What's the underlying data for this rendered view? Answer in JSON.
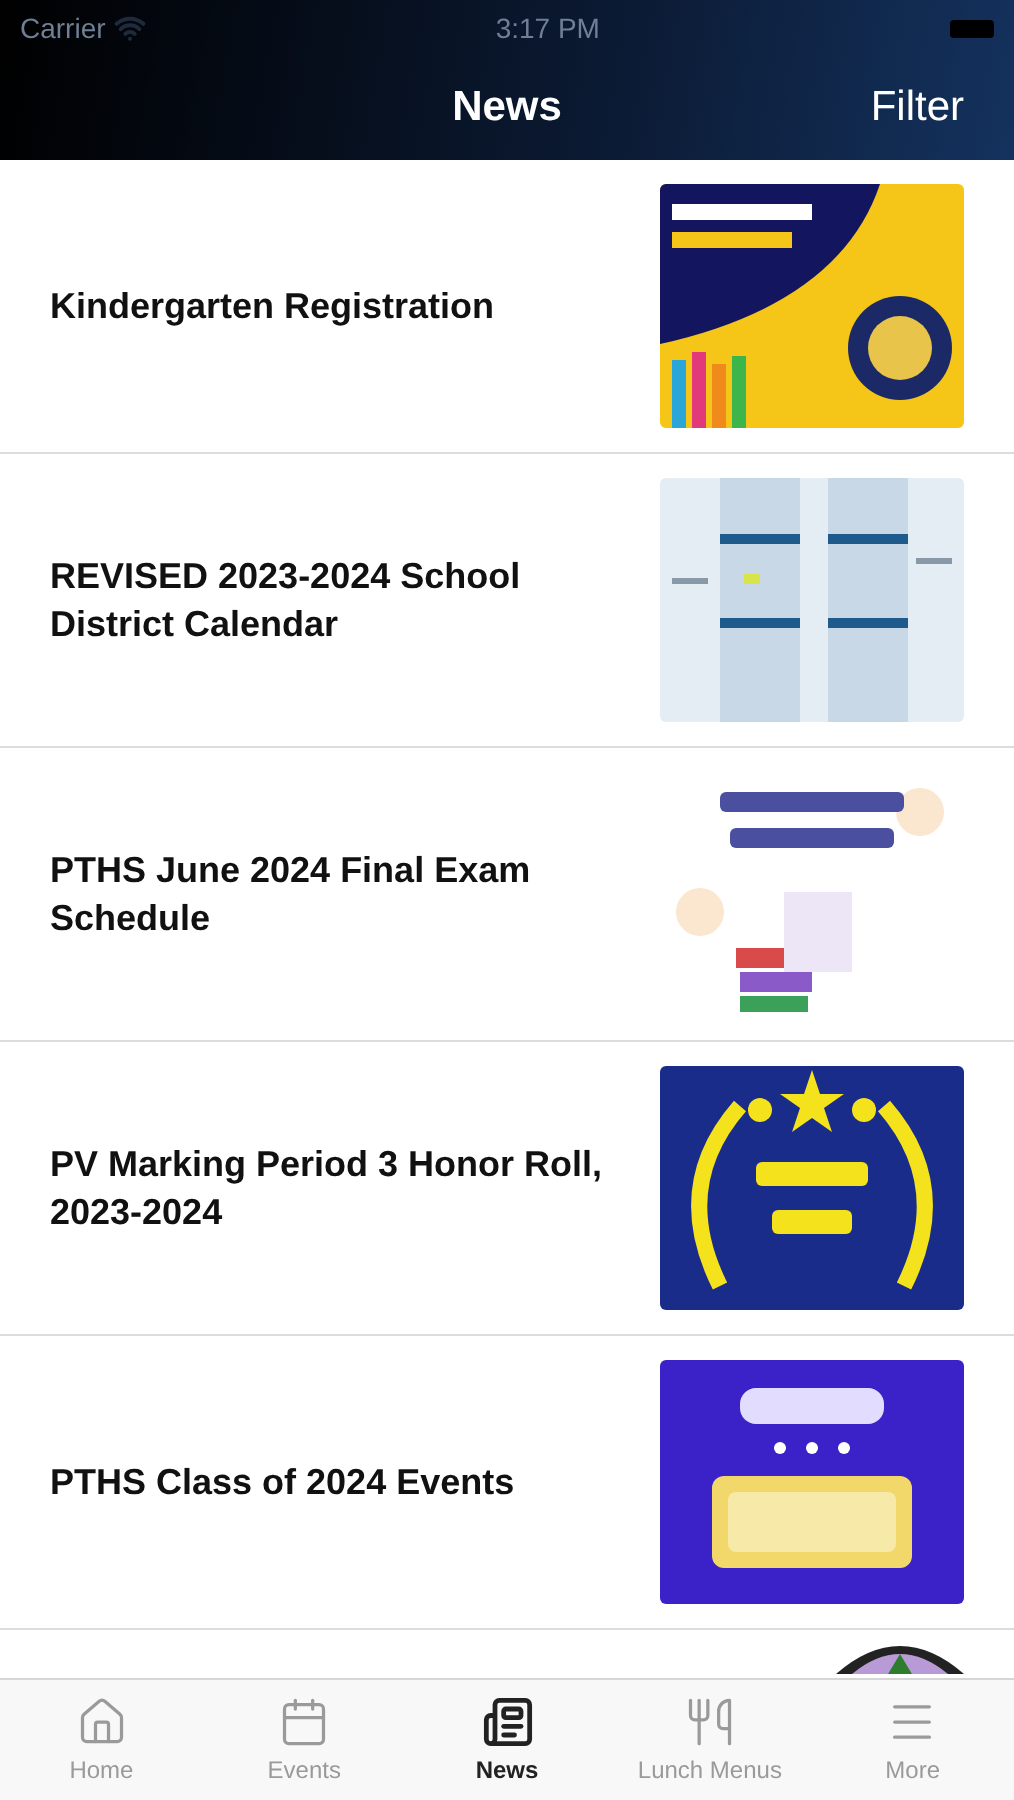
{
  "status_bar": {
    "carrier": "Carrier",
    "time": "3:17 PM"
  },
  "nav_bar": {
    "title": "News",
    "action": "Filter"
  },
  "items": [
    {
      "kind": "article",
      "title": "Kindergarten Registration"
    },
    {
      "kind": "article",
      "title": "REVISED 2023-2024 School District Calendar"
    },
    {
      "kind": "article",
      "title": "PTHS June 2024 Final Exam Schedule"
    },
    {
      "kind": "article",
      "title": "PV Marking Period 3 Honor Roll, 2023-2024"
    },
    {
      "kind": "article",
      "title": "PTHS Class of 2024 Events"
    },
    {
      "kind": "picture"
    }
  ],
  "tab_bar": [
    {
      "label": "Home",
      "selected": false
    },
    {
      "label": "Events",
      "selected": false
    },
    {
      "label": "News",
      "selected": true
    },
    {
      "label": "Lunch Menus",
      "selected": false
    },
    {
      "label": "More",
      "selected": false
    }
  ]
}
